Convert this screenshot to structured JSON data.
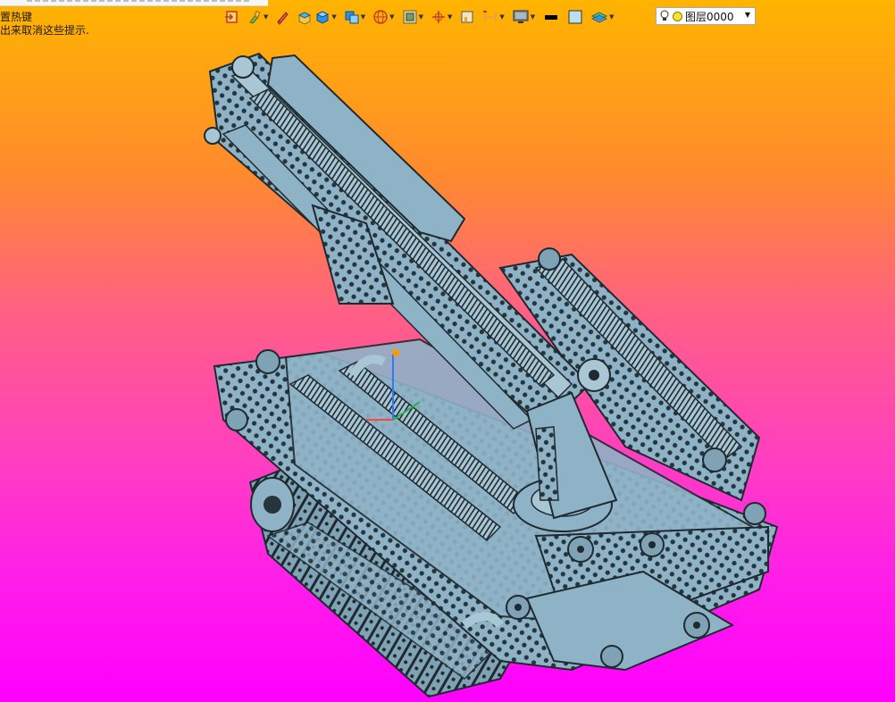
{
  "hints": {
    "line1": "置热键",
    "line2": "出来取消这些提示."
  },
  "toolbar": {
    "buttons": [
      {
        "name": "exit-sketch-icon",
        "has_menu": false
      },
      {
        "name": "paint-brush-icon",
        "has_menu": true
      },
      {
        "name": "pen-icon",
        "has_menu": false
      },
      {
        "name": "shaded-box-icon",
        "has_menu": false
      },
      {
        "name": "blue-cube-icon",
        "has_menu": true
      },
      {
        "name": "view-orient-icon",
        "has_menu": true
      },
      {
        "name": "sphere-grid-icon",
        "has_menu": true
      },
      {
        "name": "display-mode-icon",
        "has_menu": true
      },
      {
        "name": "axis-icon",
        "has_menu": true
      },
      {
        "name": "section-icon",
        "has_menu": false
      },
      {
        "name": "clip-plane-icon",
        "has_menu": true
      },
      {
        "name": "monitor-icon",
        "has_menu": true
      },
      {
        "name": "black-line-icon",
        "has_menu": false
      },
      {
        "name": "color-swatch-icon",
        "has_menu": false
      },
      {
        "name": "layers-icon",
        "has_menu": true
      }
    ]
  },
  "layer": {
    "current": "图层0000",
    "dot_color": "#ffe12a"
  },
  "viewport": {
    "bg_top": "#ffb400",
    "bg_bottom": "#ff00ff",
    "model_color": "#8fb3c6",
    "model_edge": "#1e2a30"
  }
}
